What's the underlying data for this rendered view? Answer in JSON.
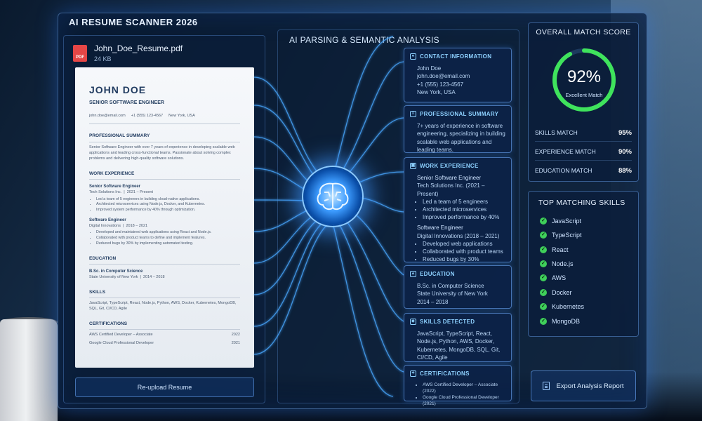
{
  "app": {
    "title": "AI RESUME SCANNER 2026"
  },
  "file": {
    "name": "John_Doe_Resume.pdf",
    "size": "24 KB",
    "icon_label": "PDF"
  },
  "resume": {
    "name": "JOHN DOE",
    "role": "SENIOR SOFTWARE ENGINEER",
    "email": "john.doe@email.com",
    "phone": "+1 (555) 123-4567",
    "location": "New York, USA",
    "summary_heading": "PROFESSIONAL SUMMARY",
    "summary": "Senior Software Engineer with over 7 years of experience in developing scalable web applications and leading cross-functional teams. Passionate about solving complex problems and delivering high-quality software solutions.",
    "experience_heading": "WORK EXPERIENCE",
    "jobs": [
      {
        "title": "Senior Software Engineer",
        "company": "Tech Solutions Inc.",
        "dates": "2021 – Present",
        "bullets": [
          "Led a team of 5 engineers in building cloud-native applications.",
          "Architected microservices using Node.js, Docker, and Kubernetes.",
          "Improved system performance by 40% through optimization."
        ]
      },
      {
        "title": "Software Engineer",
        "company": "Digital Innovations",
        "dates": "2018 – 2021",
        "bullets": [
          "Developed and maintained web applications using React and Node.js.",
          "Collaborated with product teams to define and implement features.",
          "Reduced bugs by 30% by implementing automated testing."
        ]
      }
    ],
    "education_heading": "EDUCATION",
    "degree": "B.Sc. in Computer Science",
    "school": "State University of New York",
    "school_dates": "2014 – 2018",
    "skills_heading": "SKILLS",
    "skills": "JavaScript, TypeScript, React, Node.js, Python, AWS, Docker, Kubernetes, MongoDB, SQL, Git, CI/CD, Agile",
    "certs_heading": "CERTIFICATIONS",
    "certs": [
      {
        "name": "AWS Certified Developer – Associate",
        "year": "2022"
      },
      {
        "name": "Google Cloud Professional Developer",
        "year": "2021"
      }
    ]
  },
  "reupload_label": "Re-upload Resume",
  "analysis": {
    "title": "AI PARSING & SEMANTIC ANALYSIS",
    "contact": {
      "heading": "CONTACT INFORMATION",
      "name": "John Doe",
      "email": "john.doe@email.com",
      "phone": "+1 (555) 123-4567",
      "location": "New York, USA"
    },
    "summary": {
      "heading": "PROFESSIONAL SUMMARY",
      "text": "7+ years of experience in software engineering, specializing in building scalable web applications and leading teams."
    },
    "experience": {
      "heading": "WORK EXPERIENCE",
      "job1_title": "Senior Software Engineer",
      "job1_company": "Tech Solutions Inc. (2021 – Present)",
      "job1_bullets": [
        "Led a team of 5 engineers",
        "Architected microservices",
        "Improved performance by 40%"
      ],
      "job2_title": "Software Engineer",
      "job2_company": "Digital Innovations (2018 – 2021)",
      "job2_bullets": [
        "Developed web applications",
        "Collaborated with product teams",
        "Reduced bugs by 30%"
      ]
    },
    "education": {
      "heading": "EDUCATION",
      "degree": "B.Sc. in Computer Science",
      "school": "State University of New York",
      "dates": "2014 – 2018"
    },
    "skills": {
      "heading": "SKILLS DETECTED",
      "text": "JavaScript, TypeScript, React, Node.js, Python, AWS, Docker, Kubernetes, MongoDB, SQL, Git, CI/CD, Agile"
    },
    "certs": {
      "heading": "CERTIFICATIONS",
      "items": [
        "AWS Certified Developer – Associate (2022)",
        "Google Cloud Professional Developer (2021)"
      ]
    }
  },
  "score": {
    "title": "OVERALL MATCH SCORE",
    "value": 92,
    "value_label": "92%",
    "caption": "Excellent Match",
    "ring_color": "#3fe35c",
    "metrics": [
      {
        "label": "SKILLS MATCH",
        "value": "95%"
      },
      {
        "label": "EXPERIENCE MATCH",
        "value": "90%"
      },
      {
        "label": "EDUCATION MATCH",
        "value": "88%"
      }
    ]
  },
  "top_skills": {
    "title": "TOP MATCHING SKILLS",
    "items": [
      "JavaScript",
      "TypeScript",
      "React",
      "Node.js",
      "AWS",
      "Docker",
      "Kubernetes",
      "MongoDB"
    ]
  },
  "export_label": "Export Analysis Report"
}
